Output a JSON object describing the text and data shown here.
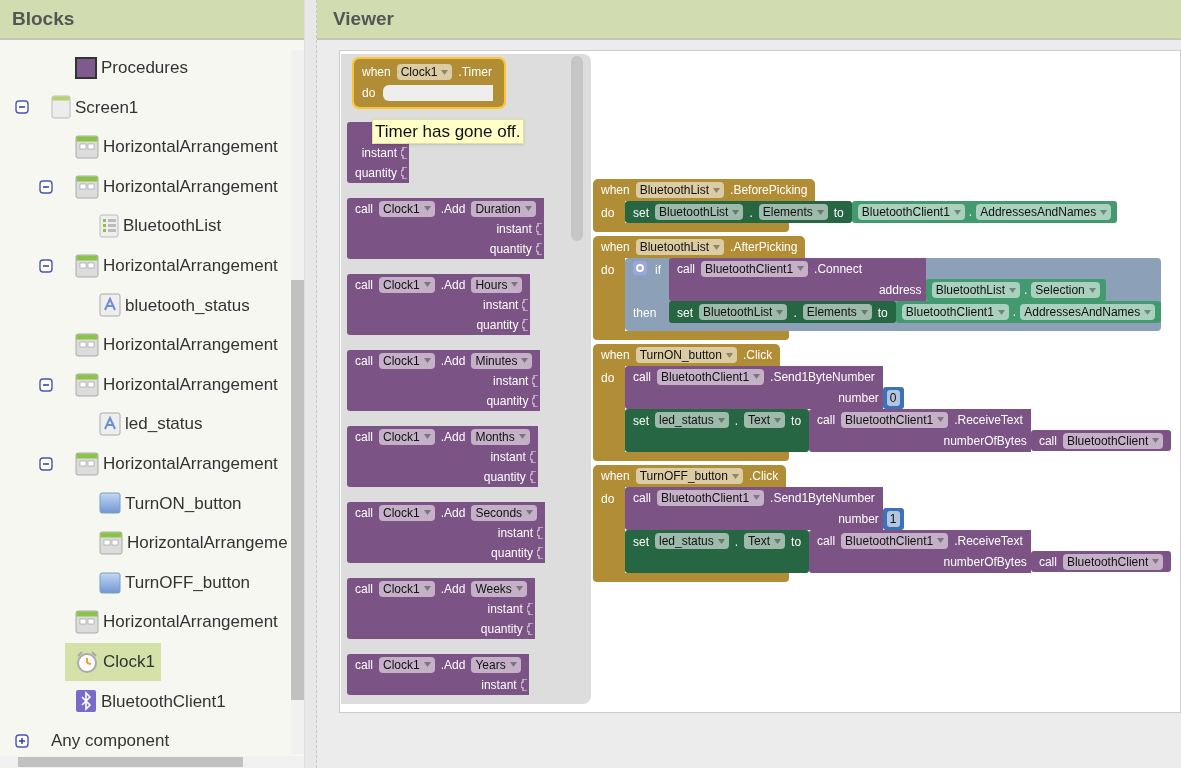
{
  "blocks_panel": {
    "title": "Blocks",
    "tree": [
      {
        "label": "Procedures",
        "kind": "procedures",
        "selected": false
      },
      {
        "label": "Screen1",
        "kind": "screen",
        "expanded": true,
        "selected": false,
        "children": [
          {
            "label": "HorizontalArrangement",
            "kind": "arrangement",
            "selected": false
          },
          {
            "label": "HorizontalArrangement",
            "kind": "arrangement",
            "expanded": true,
            "selected": false,
            "children": [
              {
                "label": "BluetoothList",
                "kind": "listpicker",
                "selected": false
              }
            ]
          },
          {
            "label": "HorizontalArrangement",
            "kind": "arrangement",
            "expanded": true,
            "selected": false,
            "children": [
              {
                "label": "bluetooth_status",
                "kind": "label",
                "selected": false
              }
            ]
          },
          {
            "label": "HorizontalArrangement",
            "kind": "arrangement",
            "selected": false
          },
          {
            "label": "HorizontalArrangement",
            "kind": "arrangement",
            "expanded": true,
            "selected": false,
            "children": [
              {
                "label": "led_status",
                "kind": "label",
                "selected": false
              }
            ]
          },
          {
            "label": "HorizontalArrangement",
            "kind": "arrangement",
            "expanded": true,
            "selected": false,
            "children": [
              {
                "label": "TurnON_button",
                "kind": "button",
                "selected": false
              },
              {
                "label": "HorizontalArrangeme",
                "kind": "arrangement",
                "selected": false
              },
              {
                "label": "TurnOFF_button",
                "kind": "button",
                "selected": false
              }
            ]
          },
          {
            "label": "HorizontalArrangement",
            "kind": "arrangement",
            "selected": false
          },
          {
            "label": "Clock1",
            "kind": "clock",
            "selected": true
          },
          {
            "label": "BluetoothClient1",
            "kind": "bluetooth",
            "selected": false
          }
        ]
      },
      {
        "label": "Any component",
        "kind": "group",
        "expanded": false,
        "selected": false
      }
    ]
  },
  "viewer": {
    "title": "Viewer",
    "flyout": {
      "event": {
        "keyword": "when",
        "component": "Clock1",
        "event": ".Timer",
        "do_label": "do",
        "selected": true
      },
      "tooltip": "Timer has gone off.",
      "blocks": [
        {
          "kind": "call",
          "args": [
            {
              "name": "instant"
            },
            {
              "name": "quantity"
            }
          ]
        },
        {
          "kind": "call",
          "keyword": "call",
          "component": "Clock1",
          "method": ".Add",
          "option": "Duration",
          "args": [
            {
              "name": "instant"
            },
            {
              "name": "quantity"
            }
          ]
        },
        {
          "kind": "call",
          "keyword": "call",
          "component": "Clock1",
          "method": ".Add",
          "option": "Hours",
          "args": [
            {
              "name": "instant"
            },
            {
              "name": "quantity"
            }
          ]
        },
        {
          "kind": "call",
          "keyword": "call",
          "component": "Clock1",
          "method": ".Add",
          "option": "Minutes",
          "args": [
            {
              "name": "instant"
            },
            {
              "name": "quantity"
            }
          ]
        },
        {
          "kind": "call",
          "keyword": "call",
          "component": "Clock1",
          "method": ".Add",
          "option": "Months",
          "args": [
            {
              "name": "instant"
            },
            {
              "name": "quantity"
            }
          ]
        },
        {
          "kind": "call",
          "keyword": "call",
          "component": "Clock1",
          "method": ".Add",
          "option": "Seconds",
          "args": [
            {
              "name": "instant"
            },
            {
              "name": "quantity"
            }
          ]
        },
        {
          "kind": "call",
          "keyword": "call",
          "component": "Clock1",
          "method": ".Add",
          "option": "Weeks",
          "args": [
            {
              "name": "instant"
            },
            {
              "name": "quantity"
            }
          ]
        },
        {
          "kind": "call",
          "keyword": "call",
          "component": "Clock1",
          "method": ".Add",
          "option": "Years",
          "args": [
            {
              "name": "instant"
            }
          ]
        }
      ]
    },
    "events": [
      {
        "keyword": "when",
        "component": "BluetoothList",
        "event": ".BeforePicking",
        "do_label": "do",
        "body": [
          {
            "kind": "set",
            "keyword": "set",
            "component": "BluetoothList",
            "dot": ".",
            "property": "Elements",
            "to": "to",
            "value": {
              "kind": "getter",
              "component": "BluetoothClient1",
              "dot": ".",
              "property": "AddressesAndNames"
            }
          }
        ]
      },
      {
        "keyword": "when",
        "component": "BluetoothList",
        "event": ".AfterPicking",
        "do_label": "do",
        "body": [
          {
            "kind": "if",
            "keyword": "if",
            "then_label": "then",
            "condition": {
              "kind": "call",
              "keyword": "call",
              "component": "BluetoothClient1",
              "method": ".Connect",
              "args": [
                {
                  "name": "address",
                  "value": {
                    "kind": "getter",
                    "component": "BluetoothList",
                    "dot": ".",
                    "property": "Selection"
                  }
                }
              ]
            },
            "then": [
              {
                "kind": "set",
                "keyword": "set",
                "component": "BluetoothList",
                "dot": ".",
                "property": "Elements",
                "to": "to",
                "value": {
                  "kind": "getter",
                  "component": "BluetoothClient1",
                  "dot": ".",
                  "property": "AddressesAndNames"
                }
              }
            ]
          }
        ]
      },
      {
        "keyword": "when",
        "component": "TurnON_button",
        "event": ".Click",
        "do_label": "do",
        "body": [
          {
            "kind": "call",
            "keyword": "call",
            "component": "BluetoothClient1",
            "method": ".Send1ByteNumber",
            "args": [
              {
                "name": "number",
                "value": {
                  "kind": "number",
                  "text": "0"
                }
              }
            ]
          },
          {
            "kind": "set",
            "keyword": "set",
            "component": "led_status",
            "dot": ".",
            "property": "Text",
            "to": "to",
            "value": {
              "kind": "call",
              "keyword": "call",
              "component": "BluetoothClient1",
              "method": ".ReceiveText",
              "args": [
                {
                  "name": "numberOfBytes",
                  "value": {
                    "kind": "call",
                    "keyword": "call",
                    "component": "BluetoothClient"
                  }
                }
              ]
            }
          }
        ]
      },
      {
        "keyword": "when",
        "component": "TurnOFF_button",
        "event": ".Click",
        "do_label": "do",
        "body": [
          {
            "kind": "call",
            "keyword": "call",
            "component": "BluetoothClient1",
            "method": ".Send1ByteNumber",
            "args": [
              {
                "name": "number",
                "value": {
                  "kind": "number",
                  "text": "1"
                }
              }
            ]
          },
          {
            "kind": "set",
            "keyword": "set",
            "component": "led_status",
            "dot": ".",
            "property": "Text",
            "to": "to",
            "value": {
              "kind": "call",
              "keyword": "call",
              "component": "BluetoothClient1",
              "method": ".ReceiveText",
              "args": [
                {
                  "name": "numberOfBytes",
                  "value": {
                    "kind": "call",
                    "keyword": "call",
                    "component": "BluetoothClient"
                  }
                }
              ]
            }
          }
        ]
      }
    ]
  }
}
